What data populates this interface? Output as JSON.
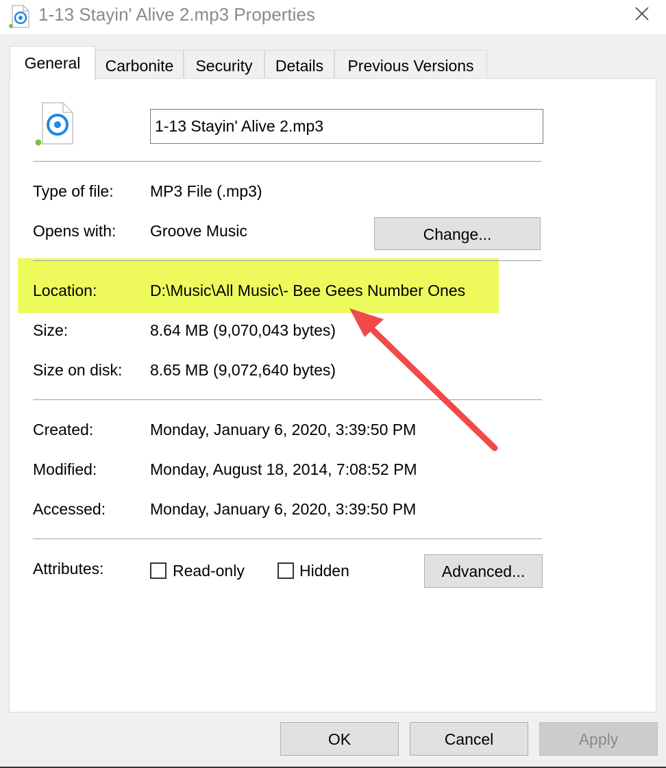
{
  "window": {
    "title": "1-13 Stayin' Alive 2.mp3 Properties"
  },
  "tabs": [
    {
      "label": "General",
      "active": true
    },
    {
      "label": "Carbonite",
      "active": false
    },
    {
      "label": "Security",
      "active": false
    },
    {
      "label": "Details",
      "active": false
    },
    {
      "label": "Previous Versions",
      "active": false
    }
  ],
  "general": {
    "file_name": "1-13 Stayin' Alive 2.mp3",
    "type_label": "Type of file:",
    "type_value": "MP3 File (.mp3)",
    "opens_label": "Opens with:",
    "opens_value": "Groove Music",
    "change_label": "Change...",
    "location_label": "Location:",
    "location_value": "D:\\Music\\All Music\\- Bee Gees Number Ones",
    "size_label": "Size:",
    "size_value": "8.64 MB (9,070,043 bytes)",
    "size_disk_label": "Size on disk:",
    "size_disk_value": "8.65 MB (9,072,640 bytes)",
    "created_label": "Created:",
    "created_value": "Monday, January 6, 2020, 3:39:50 PM",
    "modified_label": "Modified:",
    "modified_value": "Monday, August 18, 2014, 7:08:52 PM",
    "accessed_label": "Accessed:",
    "accessed_value": "Monday, January 6, 2020, 3:39:50 PM",
    "attributes_label": "Attributes:",
    "readonly_label": "Read-only",
    "readonly_checked": false,
    "hidden_label": "Hidden",
    "hidden_checked": false,
    "advanced_label": "Advanced..."
  },
  "footer": {
    "ok_label": "OK",
    "cancel_label": "Cancel",
    "apply_label": "Apply",
    "apply_disabled": true
  },
  "annotation": {
    "highlight_color": "#eef95c",
    "arrow_color": "#f04a4a"
  },
  "colors": {
    "accent": "#1e88e5",
    "file_icon_dot": "#7cc242"
  }
}
